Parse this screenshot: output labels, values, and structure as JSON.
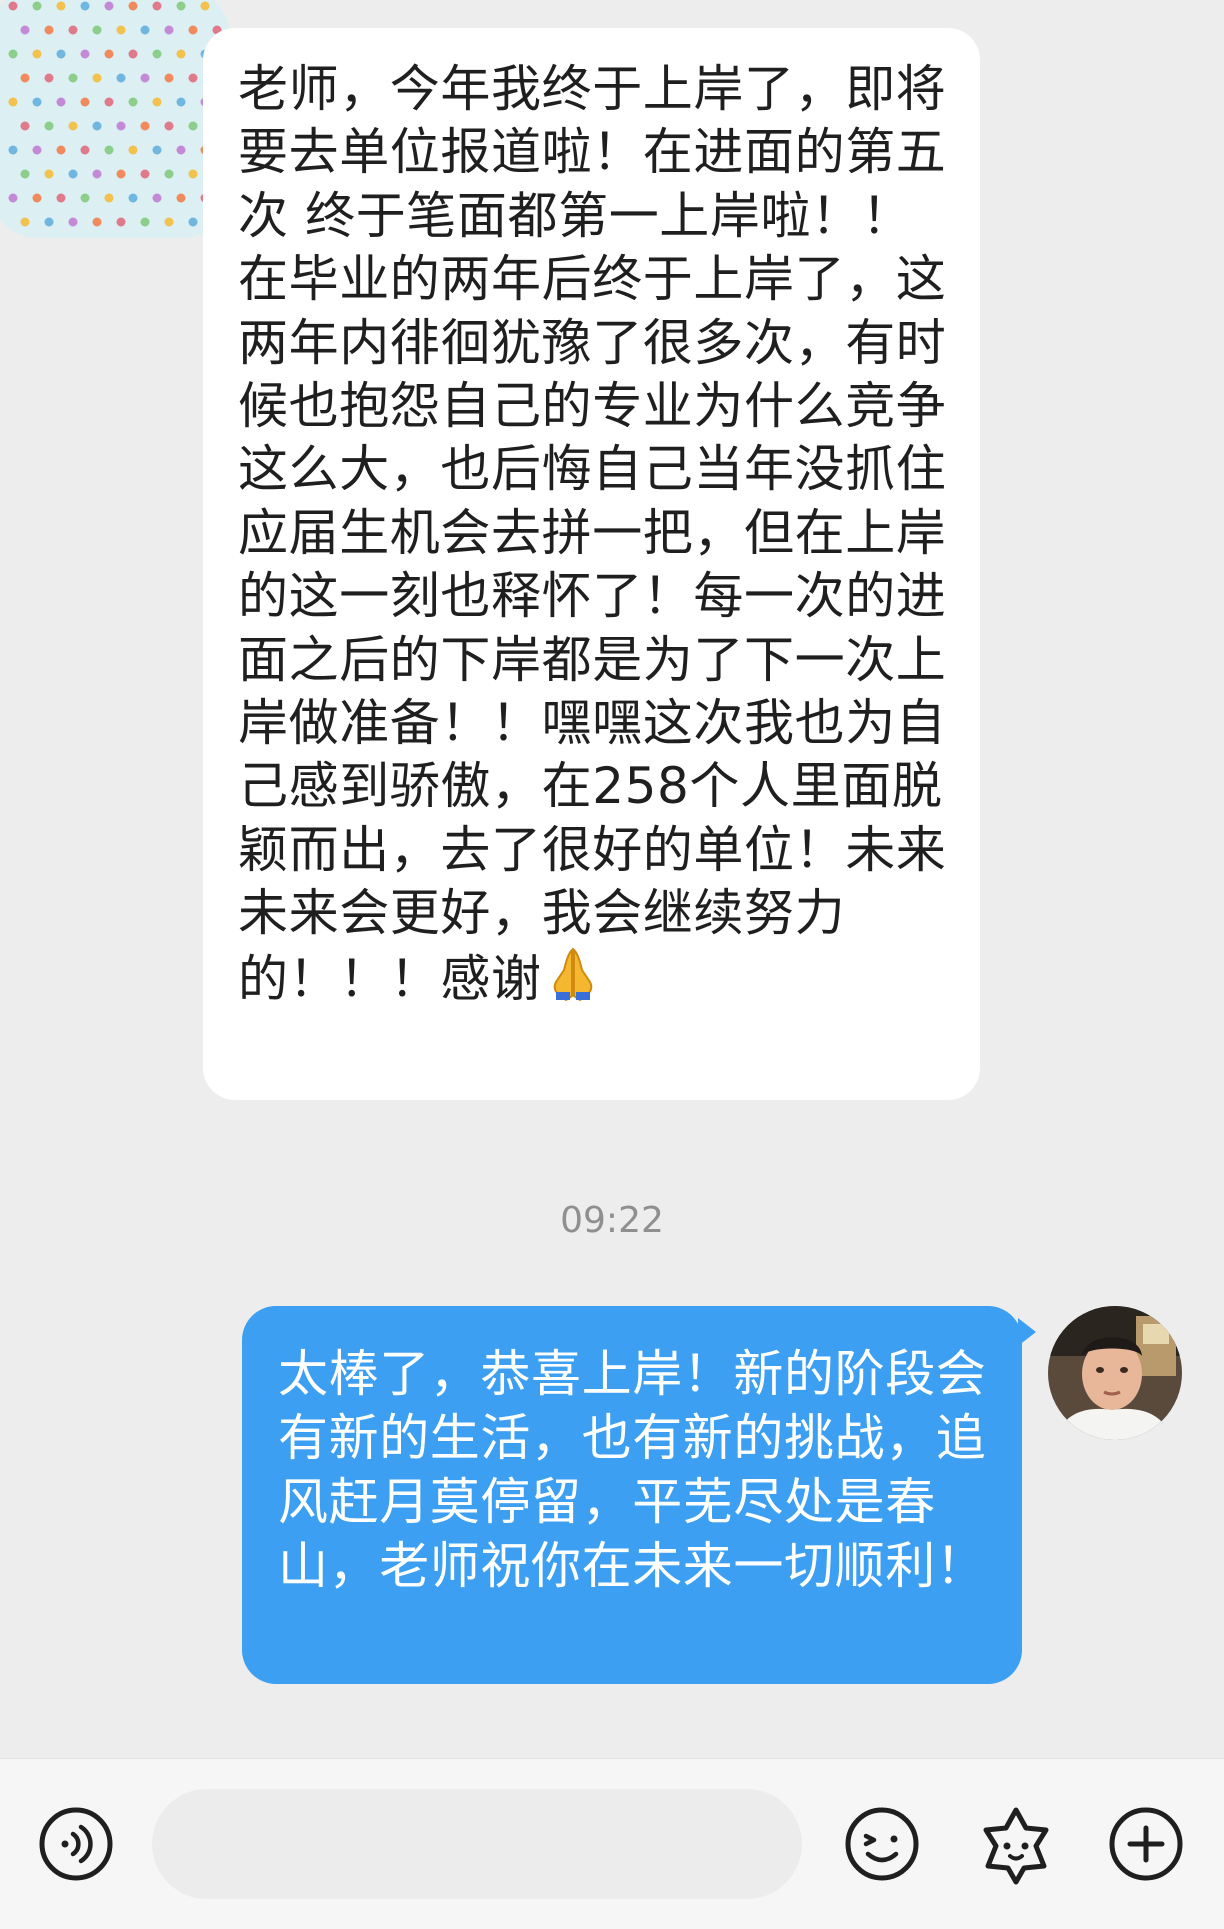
{
  "incoming_message": {
    "text": "老师，今年我终于上岸了，即将要去单位报道啦！在进面的第五次 终于笔面都第一上岸啦！！在毕业的两年后终于上岸了，这两年内徘徊犹豫了很多次，有时候也抱怨自己的专业为什么竞争这么大，也后悔自己当年没抓住应届生机会去拼一把，但在上岸的这一刻也释怀了！每一次的进面之后的下岸都是为了下一次上岸做准备！！嘿嘿这次我也为自己感到骄傲，在258个人里面脱颖而出，去了很好的单位！未来未来会更好，我会继续努力的！！！感谢",
    "emoji": "praying-hands-icon"
  },
  "timestamp": "09:22",
  "outgoing_message": {
    "text": "太棒了，恭喜上岸！新的阶段会有新的生活，也有新的挑战，追风赶月莫停留，平芜尽处是春山，老师祝你在未来一切顺利！"
  },
  "input_bar": {
    "voice_icon": "voice-icon",
    "placeholder": "",
    "emoji_icon": "smiley-icon",
    "sticker_icon": "sticker-icon",
    "more_icon": "plus-icon"
  },
  "colors": {
    "background": "#ededed",
    "incoming_bubble": "#ffffff",
    "outgoing_bubble": "#3d9ff1",
    "timestamp": "#8f8f8f"
  }
}
